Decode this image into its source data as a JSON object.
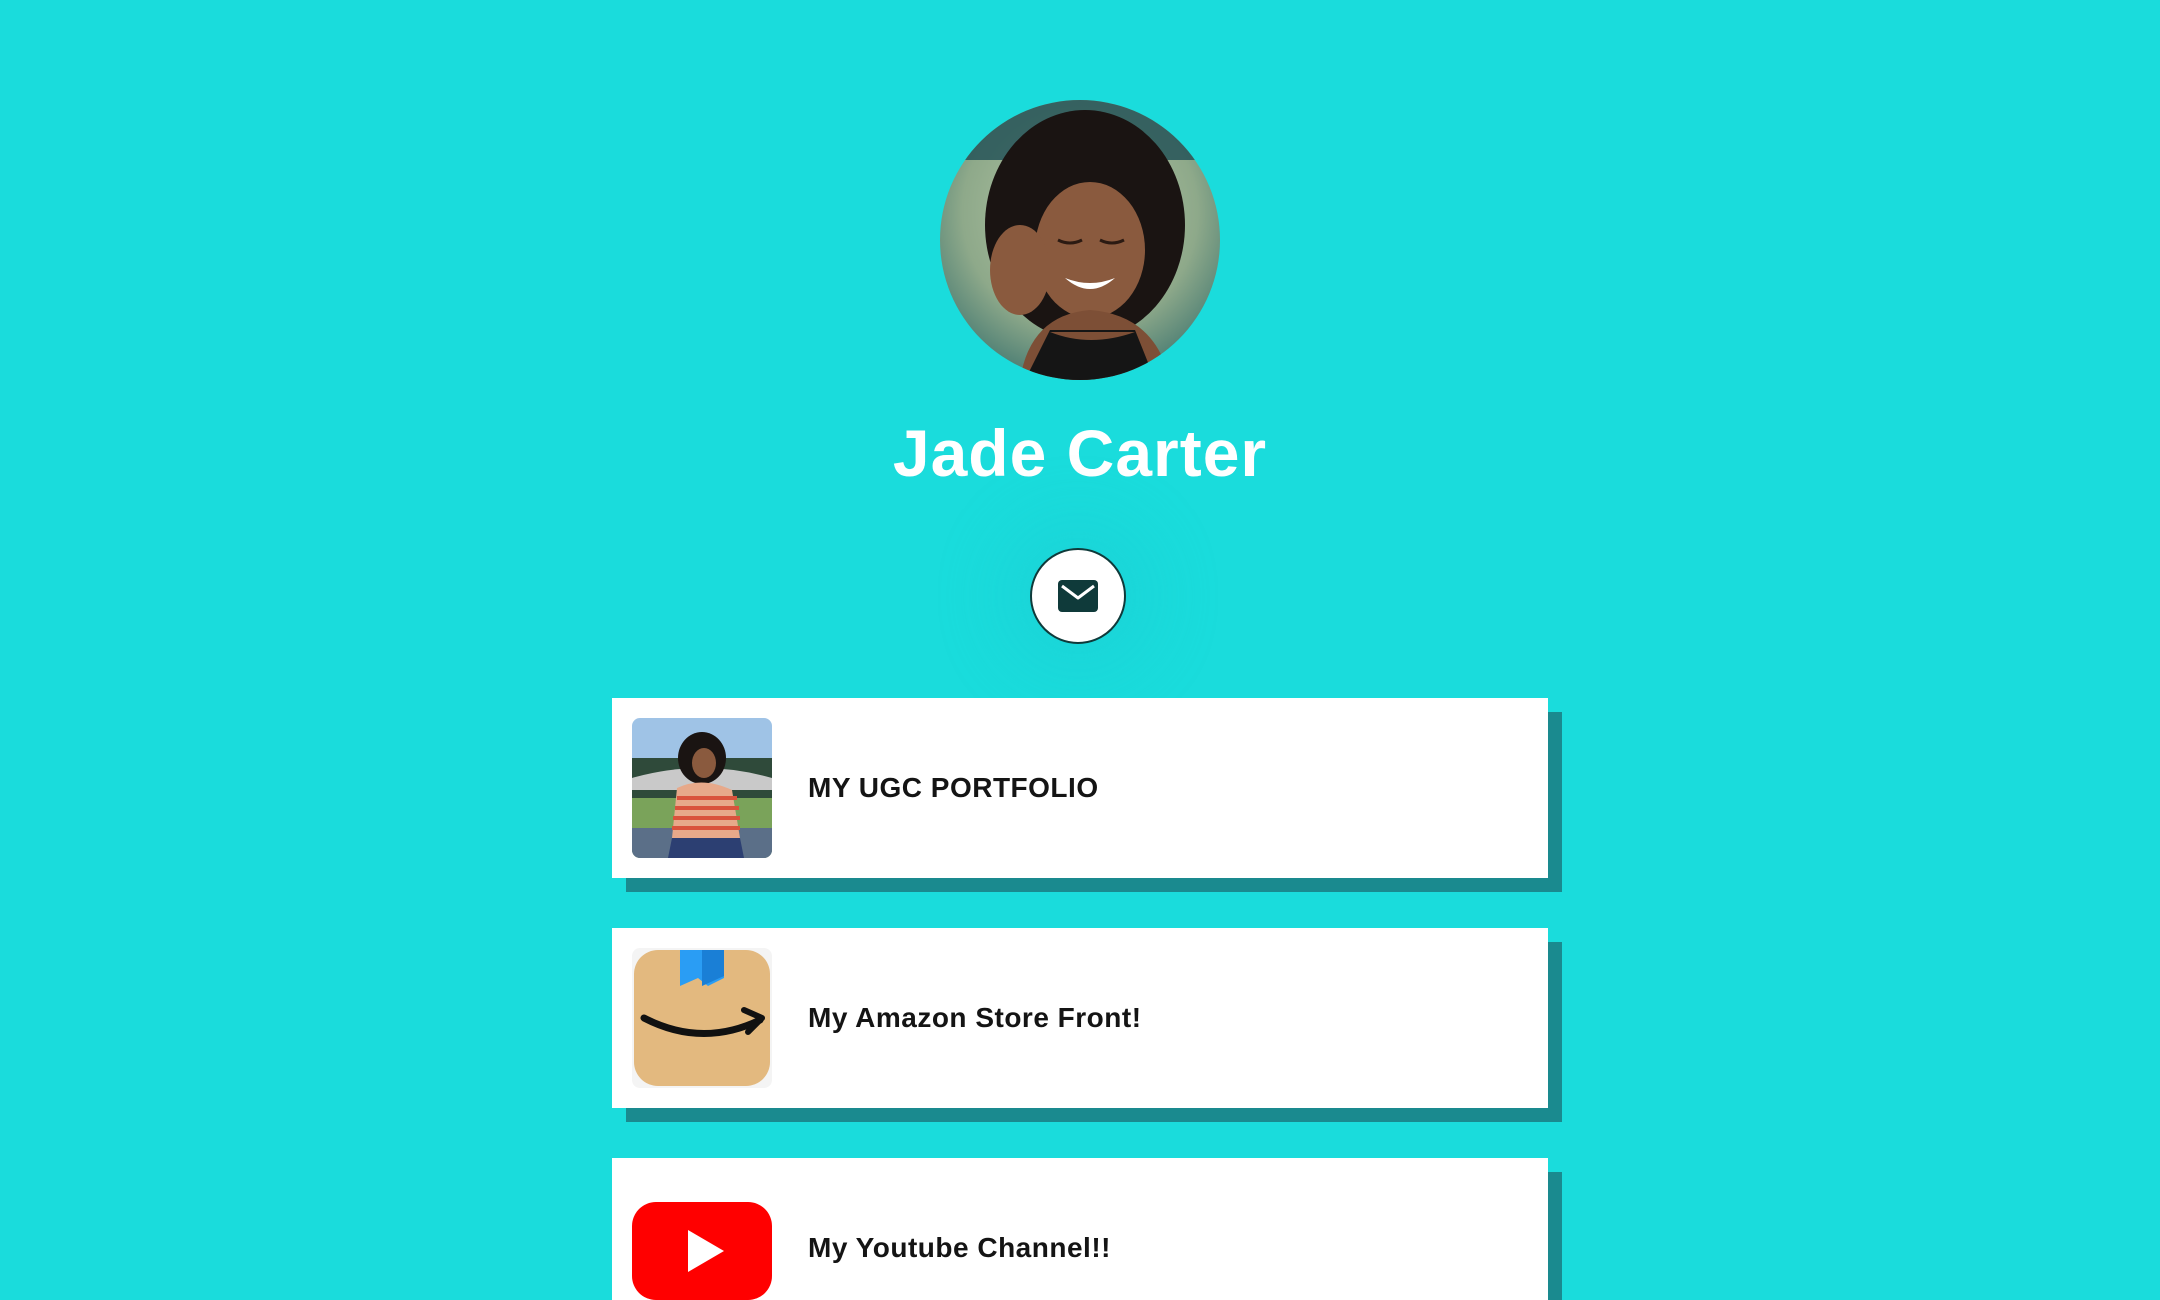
{
  "profile": {
    "name": "Jade Carter",
    "avatar_icon": "profile-photo"
  },
  "contact": {
    "email_icon": "envelope-icon"
  },
  "links": [
    {
      "label": "MY UGC PORTFOLIO",
      "icon": "portfolio-photo-thumbnail"
    },
    {
      "label": "My Amazon Store Front!",
      "icon": "amazon-app-icon"
    },
    {
      "label": "My Youtube Channel!!",
      "icon": "youtube-icon"
    }
  ],
  "colors": {
    "background": "#1adcdc",
    "card": "#ffffff",
    "card_shadow": "#1a8a8f",
    "name_text": "#ffffff",
    "link_text": "#141414",
    "youtube_red": "#ff0000",
    "amazon_tan": "#e3b97f"
  }
}
